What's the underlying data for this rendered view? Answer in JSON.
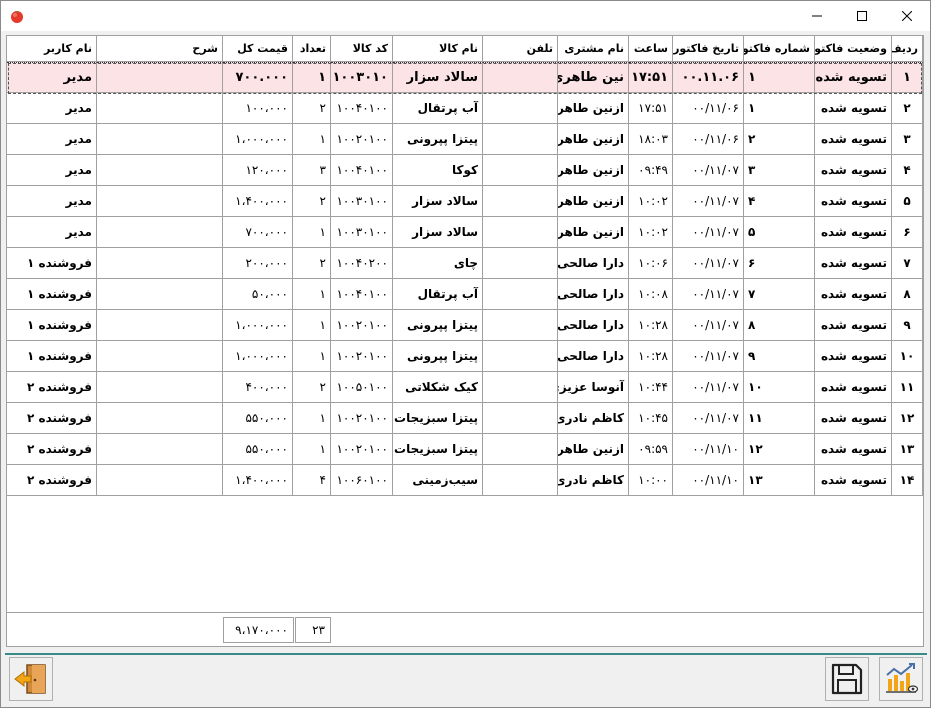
{
  "window": {
    "controls": {
      "minimize": "minimize-icon",
      "maximize": "maximize-icon",
      "close": "close-icon"
    }
  },
  "grid": {
    "columns": [
      "ردیف",
      "وضعیت فاکتور",
      "شماره فاکتور",
      "تاریخ فاکتور",
      "ساعت",
      "نام مشتری",
      "تلفن",
      "نام کالا",
      "کد کالا",
      "تعداد",
      "قیمت کل",
      "شرح",
      "نام کاربر"
    ],
    "rows": [
      [
        "۱",
        "تسویه شده",
        "۱",
        "۰۰.۱۱.۰۶",
        "۱۷:۵۱",
        "نین طاهری",
        "",
        "سالاد سزار",
        "۱۰۰۳۰۱۰",
        "۱",
        "۷۰۰.۰۰۰",
        "",
        "مدیر"
      ],
      [
        "۲",
        "تسویه شده",
        "۱",
        "۰۰/۱۱/۰۶",
        "۱۷:۵۱",
        "ازنین طاهری",
        "",
        "آب پرتقال",
        "۱۰۰۴۰۱۰۰",
        "۲",
        "۱۰۰،۰۰۰",
        "",
        "مدیر"
      ],
      [
        "۳",
        "تسویه شده",
        "۲",
        "۰۰/۱۱/۰۶",
        "۱۸:۰۳",
        "ازنین طاهری",
        "",
        "پیتزا پپرونی",
        "۱۰۰۲۰۱۰۰",
        "۱",
        "۱،۰۰۰،۰۰۰",
        "",
        "مدیر"
      ],
      [
        "۴",
        "تسویه شده",
        "۳",
        "۰۰/۱۱/۰۷",
        "۰۹:۴۹",
        "ازنین طاهری",
        "",
        "کوکا",
        "۱۰۰۴۰۱۰۰",
        "۳",
        "۱۲۰،۰۰۰",
        "",
        "مدیر"
      ],
      [
        "۵",
        "تسویه شده",
        "۴",
        "۰۰/۱۱/۰۷",
        "۱۰:۰۲",
        "ازنین طاهری",
        "",
        "سالاد سزار",
        "۱۰۰۳۰۱۰۰",
        "۲",
        "۱،۴۰۰،۰۰۰",
        "",
        "مدیر"
      ],
      [
        "۶",
        "تسویه شده",
        "۵",
        "۰۰/۱۱/۰۷",
        "۱۰:۰۲",
        "ازنین طاهری",
        "",
        "سالاد سزار",
        "۱۰۰۳۰۱۰۰",
        "۱",
        "۷۰۰،۰۰۰",
        "",
        "مدیر"
      ],
      [
        "۷",
        "تسویه شده",
        "۶",
        "۰۰/۱۱/۰۷",
        "۱۰:۰۶",
        "دارا صالحی",
        "",
        "چای",
        "۱۰۰۴۰۲۰۰",
        "۲",
        "۲۰۰،۰۰۰",
        "",
        "فروشنده ۱"
      ],
      [
        "۸",
        "تسویه شده",
        "۷",
        "۰۰/۱۱/۰۷",
        "۱۰:۰۸",
        "دارا صالحی",
        "",
        "آب پرتقال",
        "۱۰۰۴۰۱۰۰",
        "۱",
        "۵۰،۰۰۰",
        "",
        "فروشنده ۱"
      ],
      [
        "۹",
        "تسویه شده",
        "۸",
        "۰۰/۱۱/۰۷",
        "۱۰:۲۸",
        "دارا صالحی",
        "",
        "پیتزا پپرونی",
        "۱۰۰۲۰۱۰۰",
        "۱",
        "۱،۰۰۰،۰۰۰",
        "",
        "فروشنده ۱"
      ],
      [
        "۱۰",
        "تسویه شده",
        "۹",
        "۰۰/۱۱/۰۷",
        "۱۰:۲۸",
        "دارا صالحی",
        "",
        "پیتزا پپرونی",
        "۱۰۰۲۰۱۰۰",
        "۱",
        "۱،۰۰۰،۰۰۰",
        "",
        "فروشنده ۱"
      ],
      [
        "۱۱",
        "تسویه شده",
        "۱۰",
        "۰۰/۱۱/۰۷",
        "۱۰:۴۴",
        "آنوسا عزیزی",
        "",
        "کیک شکلاتی",
        "۱۰۰۵۰۱۰۰",
        "۲",
        "۴۰۰،۰۰۰",
        "",
        "فروشنده ۲"
      ],
      [
        "۱۲",
        "تسویه شده",
        "۱۱",
        "۰۰/۱۱/۰۷",
        "۱۰:۴۵",
        "کاظم نادری",
        "",
        "پیتزا سبزیجات",
        "۱۰۰۲۰۱۰۰",
        "۱",
        "۵۵۰،۰۰۰",
        "",
        "فروشنده ۲"
      ],
      [
        "۱۳",
        "تسویه شده",
        "۱۲",
        "۰۰/۱۱/۱۰",
        "۰۹:۵۹",
        "ازنین طاهری",
        "",
        "پیتزا سبزیجات",
        "۱۰۰۲۰۱۰۰",
        "۱",
        "۵۵۰،۰۰۰",
        "",
        "فروشنده ۲"
      ],
      [
        "۱۴",
        "تسویه شده",
        "۱۳",
        "۰۰/۱۱/۱۰",
        "۱۰:۰۰",
        "کاظم نادری",
        "",
        "سیب‌زمینی",
        "۱۰۰۶۰۱۰۰",
        "۴",
        "۱،۴۰۰،۰۰۰",
        "",
        "فروشنده ۲"
      ]
    ]
  },
  "footer": {
    "total_qty": "۲۳",
    "total_price": "۹،۱۷۰،۰۰۰"
  },
  "toolbar": {
    "exit": "exit-icon",
    "save": "save-icon",
    "report": "chart-report-icon"
  }
}
